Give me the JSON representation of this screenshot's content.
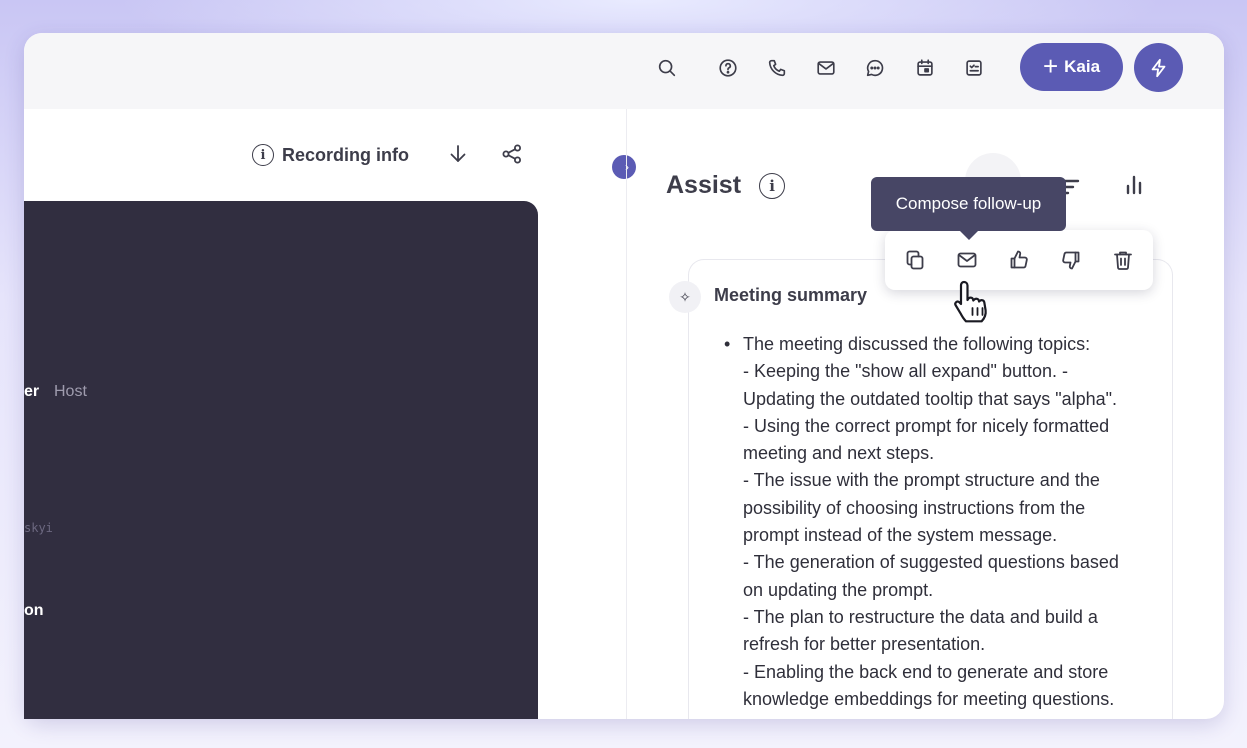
{
  "topbar": {
    "icons": [
      "search-icon",
      "help-icon",
      "phone-icon",
      "mail-icon",
      "chat-icon",
      "calendar-icon",
      "task-icon"
    ],
    "kaia_button": {
      "label": "Kaia",
      "plus": "+"
    },
    "bolt_icon": "bolt-icon",
    "accent": "#5b5bb4"
  },
  "recording": {
    "info_label": "Recording info",
    "download_icon": "download-icon",
    "share_icon": "share-icon"
  },
  "participants": {
    "role_fragment": "er",
    "host_label": "Host",
    "email_fragment": "skyi",
    "name_fragment": "on"
  },
  "assist": {
    "title": "Assist",
    "tooltip": "Compose follow-up",
    "toolbar_icons": [
      "copy-icon",
      "mail-icon",
      "thumbs-up-icon",
      "thumbs-down-icon",
      "trash-icon"
    ],
    "card_title": "Meeting summary",
    "bullet": "•",
    "summary_lines": [
      "The meeting discussed the following topics:",
      "- Keeping the \"show all expand\" button. -",
      "Updating the outdated tooltip that says \"alpha\".",
      "- Using the correct prompt for nicely formatted",
      "meeting and next steps.",
      "- The issue with the prompt structure and the",
      "possibility of choosing instructions from the",
      "prompt instead of the system message.",
      "- The generation of suggested questions based",
      "on updating the prompt.",
      "- The plan to restructure the data and build a",
      "refresh for better presentation.",
      "- Enabling the back end to generate and store",
      "knowledge embeddings for meeting questions."
    ]
  }
}
